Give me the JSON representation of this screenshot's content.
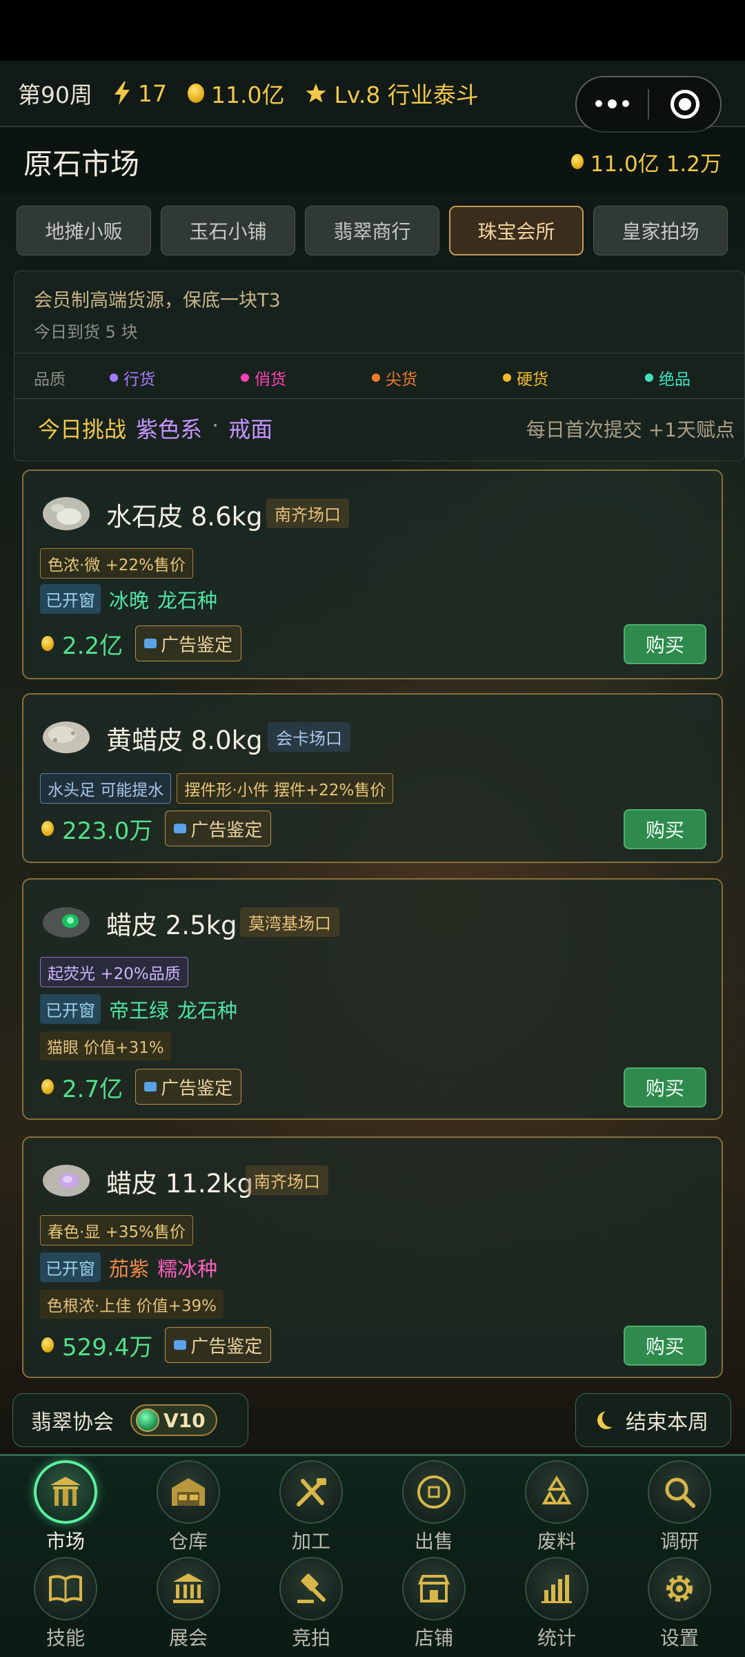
{
  "hud": {
    "week": "第90周",
    "energy": "17",
    "money": "11.0亿",
    "level": "Lv.8 行业泰斗"
  },
  "market": {
    "title": "原石市场",
    "money": "11.0亿",
    "secondary": "1.2万"
  },
  "tabs": [
    {
      "label": "地摊小贩"
    },
    {
      "label": "玉石小铺"
    },
    {
      "label": "翡翠商行"
    },
    {
      "label": "珠宝会所",
      "active": true
    },
    {
      "label": "皇家拍场"
    }
  ],
  "info": {
    "desc": "会员制高端货源，保底一块T3",
    "arrival": "今日到货 5 块",
    "quality_label": "品质",
    "qualities": [
      {
        "label": "行货",
        "color": "#a77bff"
      },
      {
        "label": "俏货",
        "color": "#ff3fb8"
      },
      {
        "label": "尖货",
        "color": "#f07a2a"
      },
      {
        "label": "硬货",
        "color": "#f2b92a"
      },
      {
        "label": "绝品",
        "color": "#3fe3c0"
      }
    ],
    "challenge_label": "今日挑战",
    "challenge_color": "紫色系",
    "challenge_dot": "·",
    "challenge_shape": "戒面",
    "reward": "每日首次提交 +1天赋点"
  },
  "cards": [
    {
      "name": "水石皮 8.6kg",
      "origin": "南齐场口",
      "tag": "色浓·微 +22%售价",
      "opened": "已开窗",
      "jade1": "冰晚",
      "jade2": "龙石种",
      "price": "2.2亿",
      "ad": "广告鉴定",
      "buy": "购买"
    },
    {
      "name": "黄蜡皮 8.0kg",
      "origin": "会卡场口",
      "tag1": "水头足 可能提水",
      "tag2": "摆件形·小件 摆件+22%售价",
      "price": "223.0万",
      "ad": "广告鉴定",
      "buy": "购买"
    },
    {
      "name": "蜡皮 2.5kg",
      "origin": "莫湾基场口",
      "tag": "起荧光 +20%品质",
      "opened": "已开窗",
      "jade1": "帝王绿",
      "jade2": "龙石种",
      "extra": "猫眼 价值+31%",
      "price": "2.7亿",
      "ad": "广告鉴定",
      "buy": "购买"
    },
    {
      "name": "蜡皮 11.2kg",
      "origin": "南齐场口",
      "tag": "春色·显 +35%售价",
      "opened": "已开窗",
      "jade1": "茄紫",
      "jade2": "糯冰种",
      "extra": "色根浓·上佳 价值+39%",
      "price": "529.4万",
      "ad": "广告鉴定",
      "buy": "购买"
    }
  ],
  "assoc": {
    "label": "翡翠协会",
    "vip": "V10"
  },
  "end_week": "结束本周",
  "nav": [
    {
      "label": "市场",
      "icon": "market-gate-icon",
      "active": true
    },
    {
      "label": "仓库",
      "icon": "warehouse-icon"
    },
    {
      "label": "加工",
      "icon": "tools-icon"
    },
    {
      "label": "出售",
      "icon": "coin-sell-icon"
    },
    {
      "label": "废料",
      "icon": "recycle-icon"
    },
    {
      "label": "调研",
      "icon": "search-icon"
    },
    {
      "label": "技能",
      "icon": "book-icon"
    },
    {
      "label": "展会",
      "icon": "museum-icon"
    },
    {
      "label": "竞拍",
      "icon": "gavel-icon"
    },
    {
      "label": "店铺",
      "icon": "shop-icon"
    },
    {
      "label": "统计",
      "icon": "bar-chart-icon"
    },
    {
      "label": "设置",
      "icon": "gear-icon"
    }
  ]
}
